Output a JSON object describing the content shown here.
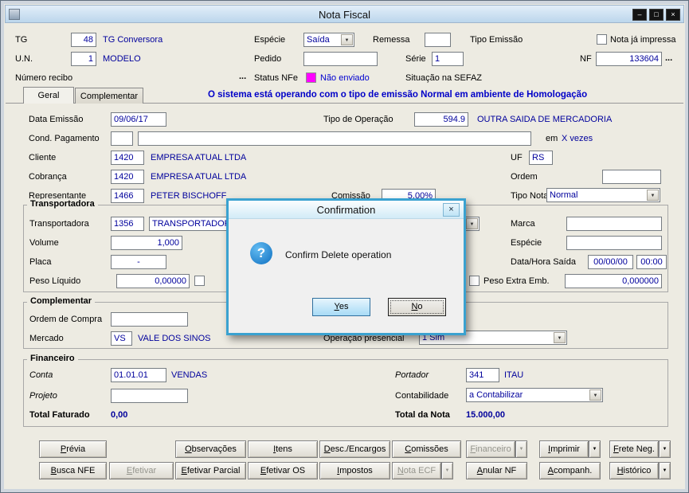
{
  "window": {
    "title": "Nota Fiscal"
  },
  "icons": {
    "minimize": "–",
    "maximize": "□",
    "close": "×",
    "combo_arrow": "▼",
    "question": "?"
  },
  "header": {
    "tg_label": "TG",
    "tg_value": "48",
    "tg_name": "TG Conversora",
    "especie_label": "Espécie",
    "especie_value": "Saída",
    "remessa_label": "Remessa",
    "remessa_value": "",
    "tipo_emissao_label": "Tipo Emissão",
    "nota_ja_impressa_label": "Nota já impressa",
    "un_label": "U.N.",
    "un_value": "1",
    "un_name": "MODELO",
    "pedido_label": "Pedido",
    "pedido_value": "",
    "serie_label": "Série",
    "serie_value": "1",
    "nf_label": "NF",
    "nf_value": "133604",
    "nf_browse": "...",
    "numero_recibo_label": "Número recibo",
    "numero_recibo_browse": "...",
    "status_nfe_label": "Status NFe",
    "status_nfe_value": "Não enviado",
    "situacao_sefaz_label": "Situação na SEFAZ"
  },
  "tabs": {
    "geral": "Geral",
    "complementar": "Complementar"
  },
  "banner": "O sistema está operando com o tipo de emissão Normal em ambiente de Homologação",
  "geral": {
    "data_emissao_label": "Data Emissão",
    "data_emissao_value": "09/06/17",
    "tipo_operacao_label": "Tipo de Operação",
    "tipo_operacao_value": "594.9",
    "tipo_operacao_name": "OUTRA SAIDA DE MERCADORIA",
    "cond_pagamento_label": "Cond. Pagamento",
    "cond_pagamento_value": "",
    "cond_pagamento_desc": "",
    "em_label": "em",
    "vezes_value": "X vezes",
    "cliente_label": "Cliente",
    "cliente_value": "1420",
    "cliente_name": "EMPRESA ATUAL LTDA",
    "uf_label": "UF",
    "uf_value": "RS",
    "cobranca_label": "Cobrança",
    "cobranca_value": "1420",
    "cobranca_name": "EMPRESA ATUAL LTDA",
    "ordem_label": "Ordem",
    "ordem_value": "",
    "representante_label": "Representante",
    "representante_value": "1466",
    "representante_name": "PETER BISCHOFF",
    "comissao_label": "Comissão",
    "comissao_value": "5,00%",
    "tipo_nota_label": "Tipo Nota",
    "tipo_nota_value": "Normal"
  },
  "transportadora": {
    "group_label": "Transportadora",
    "transportadora_label": "Transportadora",
    "transportadora_value": "1356",
    "transportadora_name": "TRANSPORTADOR",
    "marca_label": "Marca",
    "marca_value": "",
    "volume_label": "Volume",
    "volume_value": "1,000",
    "especie_label": "Espécie",
    "especie_value": "",
    "placa_label": "Placa",
    "placa_value": "-",
    "data_hora_saida_label": "Data/Hora Saída",
    "data_saida_value": "00/00/00",
    "hora_saida_value": "00:00",
    "peso_liquido_label": "Peso Líquido",
    "peso_liquido_value": "0,00000",
    "peso_extra_label": "Peso Extra Emb.",
    "peso_extra_value": "0,000000"
  },
  "complementar": {
    "group_label": "Complementar",
    "ordem_compra_label": "Ordem de Compra",
    "ordem_compra_value": "",
    "mercado_label": "Mercado",
    "mercado_value": "VS",
    "mercado_name": "VALE DOS SINOS",
    "operacao_presencial_label": "Operação presencial",
    "operacao_presencial_value": "1 Sim"
  },
  "financeiro": {
    "group_label": "Financeiro",
    "conta_label": "Conta",
    "conta_value": "01.01.01",
    "conta_name": "VENDAS",
    "portador_label": "Portador",
    "portador_value": "341",
    "portador_name": "ITAU",
    "projeto_label": "Projeto",
    "projeto_value": "",
    "contabilidade_label": "Contabilidade",
    "contabilidade_value": "a Contabilizar",
    "total_faturado_label": "Total Faturado",
    "total_faturado_value": "0,00",
    "total_nota_label": "Total da Nota",
    "total_nota_value": "15.000,00"
  },
  "toolbar": {
    "previa": "Prévia",
    "observacoes": "Observações",
    "itens": "Itens",
    "desc_encargos": "Desc./Encargos",
    "comissoes": "Comissões",
    "financeiro": "Financeiro",
    "imprimir": "Imprimir",
    "frete_neg": "Frete Neg.",
    "busca_nfe": "Busca NFE",
    "efetivar": "Efetivar",
    "efetivar_parcial": "Efetivar Parcial",
    "efetivar_os": "Efetivar OS",
    "impostos": "Impostos",
    "nota_ecf": "Nota ECF",
    "anular_nf": "Anular NF",
    "acompanh": "Acompanh.",
    "historico": "Histórico"
  },
  "dialog": {
    "title": "Confirmation",
    "message": "Confirm Delete operation",
    "yes_label": "Yes",
    "no_label": "No"
  },
  "colors": {
    "value_text": "#00009C",
    "status_nfe_indicator": "#FF00FF",
    "banner_text": "#0000C8",
    "dialog_border": "#3AA2D0",
    "default_button_fill": "#A7DBF6"
  }
}
